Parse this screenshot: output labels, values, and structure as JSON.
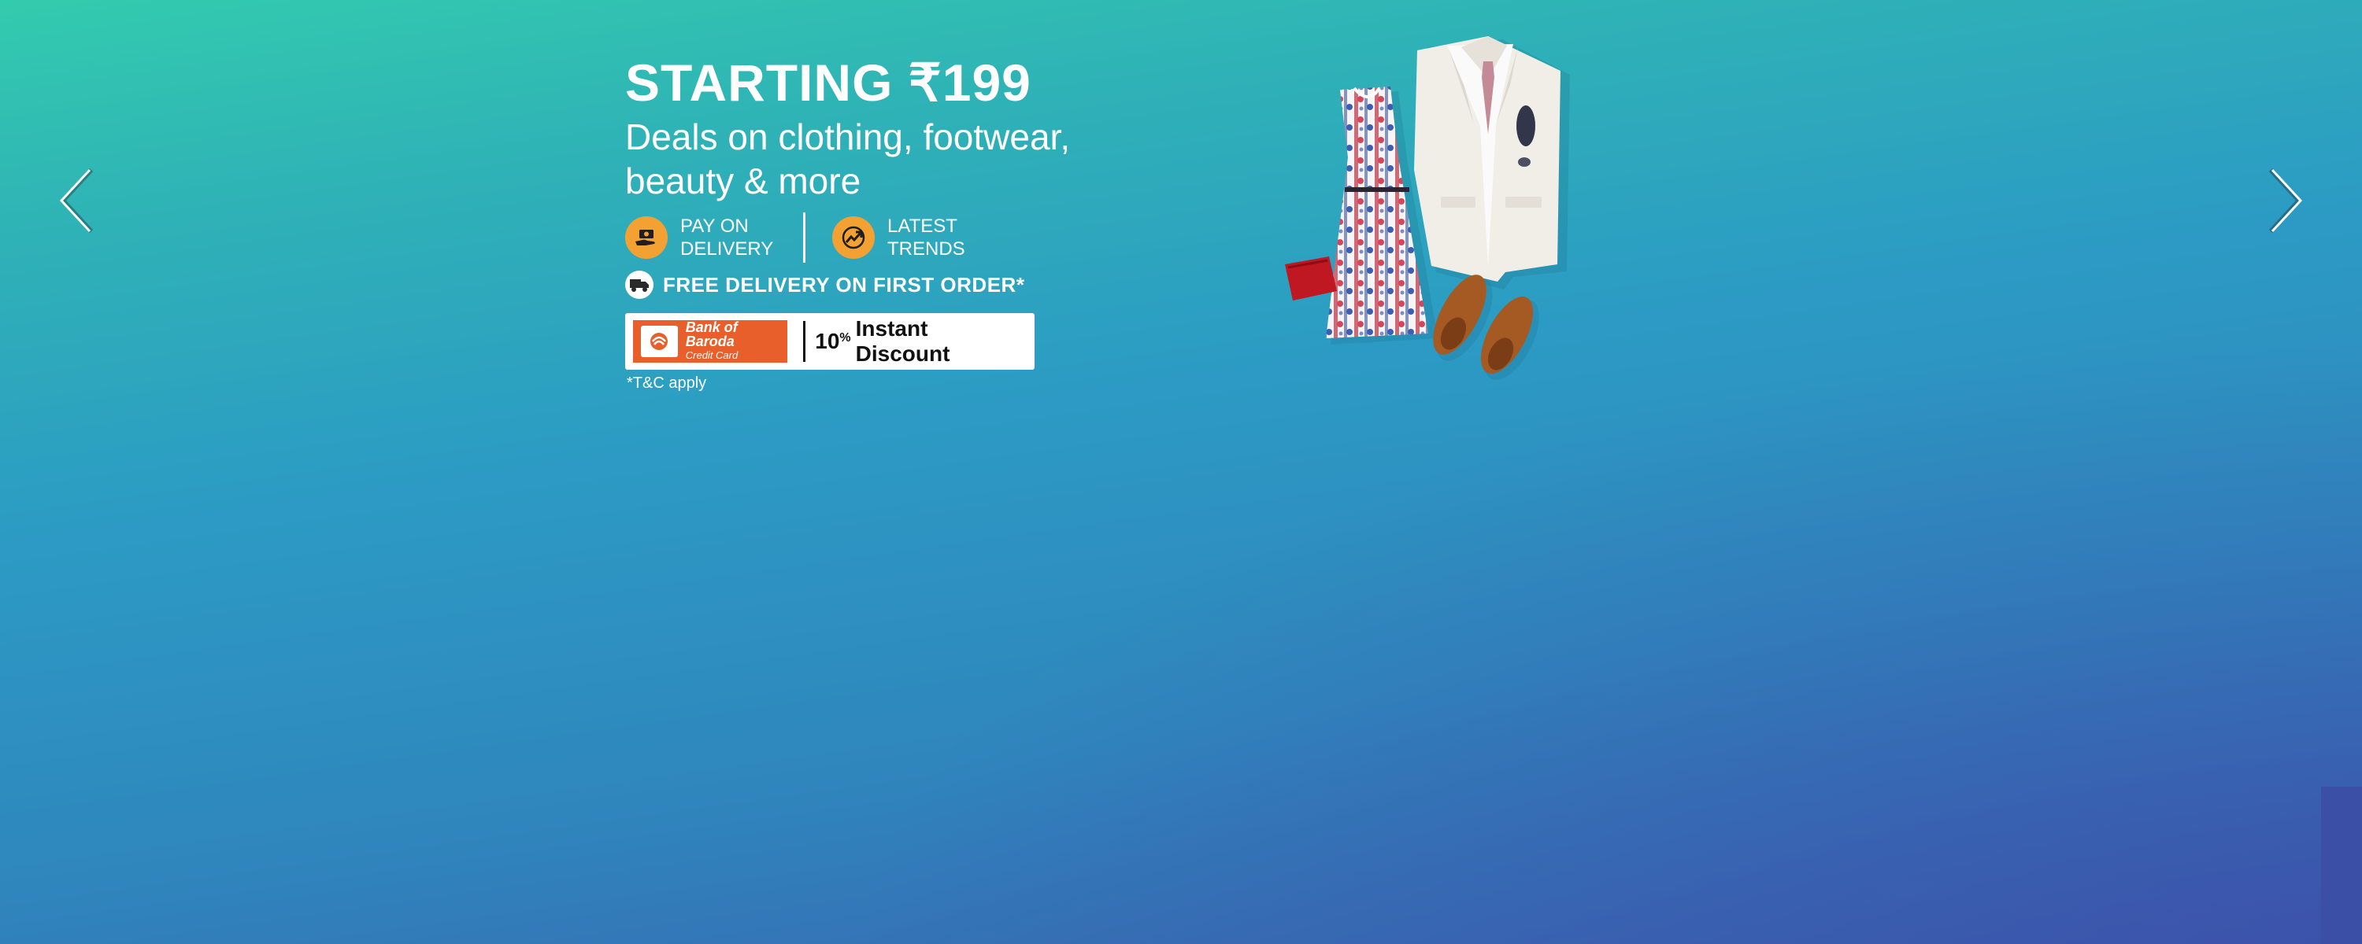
{
  "banner": {
    "headline": "STARTING ₹199",
    "subline": "Deals on clothing, footwear, beauty & more",
    "features": [
      {
        "icon": "cash-hand-icon",
        "label": "PAY ON\nDELIVERY"
      },
      {
        "icon": "trending-arrow-icon",
        "label": "LATEST\nTRENDS"
      }
    ],
    "delivery": {
      "icon": "truck-icon",
      "text": "FREE DELIVERY ON FIRST ORDER*"
    },
    "offer": {
      "bank_name": "Bank of Baroda",
      "card_type": "Credit Card",
      "discount_number": "10",
      "discount_percent": "%",
      "discount_label": "Instant Discount"
    },
    "tnc": "*T&C apply"
  },
  "navigation": {
    "prev_icon": "chevron-left-icon",
    "next_icon": "chevron-right-icon"
  },
  "colors": {
    "gradient_top": "#33cbae",
    "gradient_mid": "#2c9bc4",
    "gradient_bottom": "#3a5fae",
    "feature_icon": "#f4a133",
    "bank_orange": "#e95f2b"
  }
}
